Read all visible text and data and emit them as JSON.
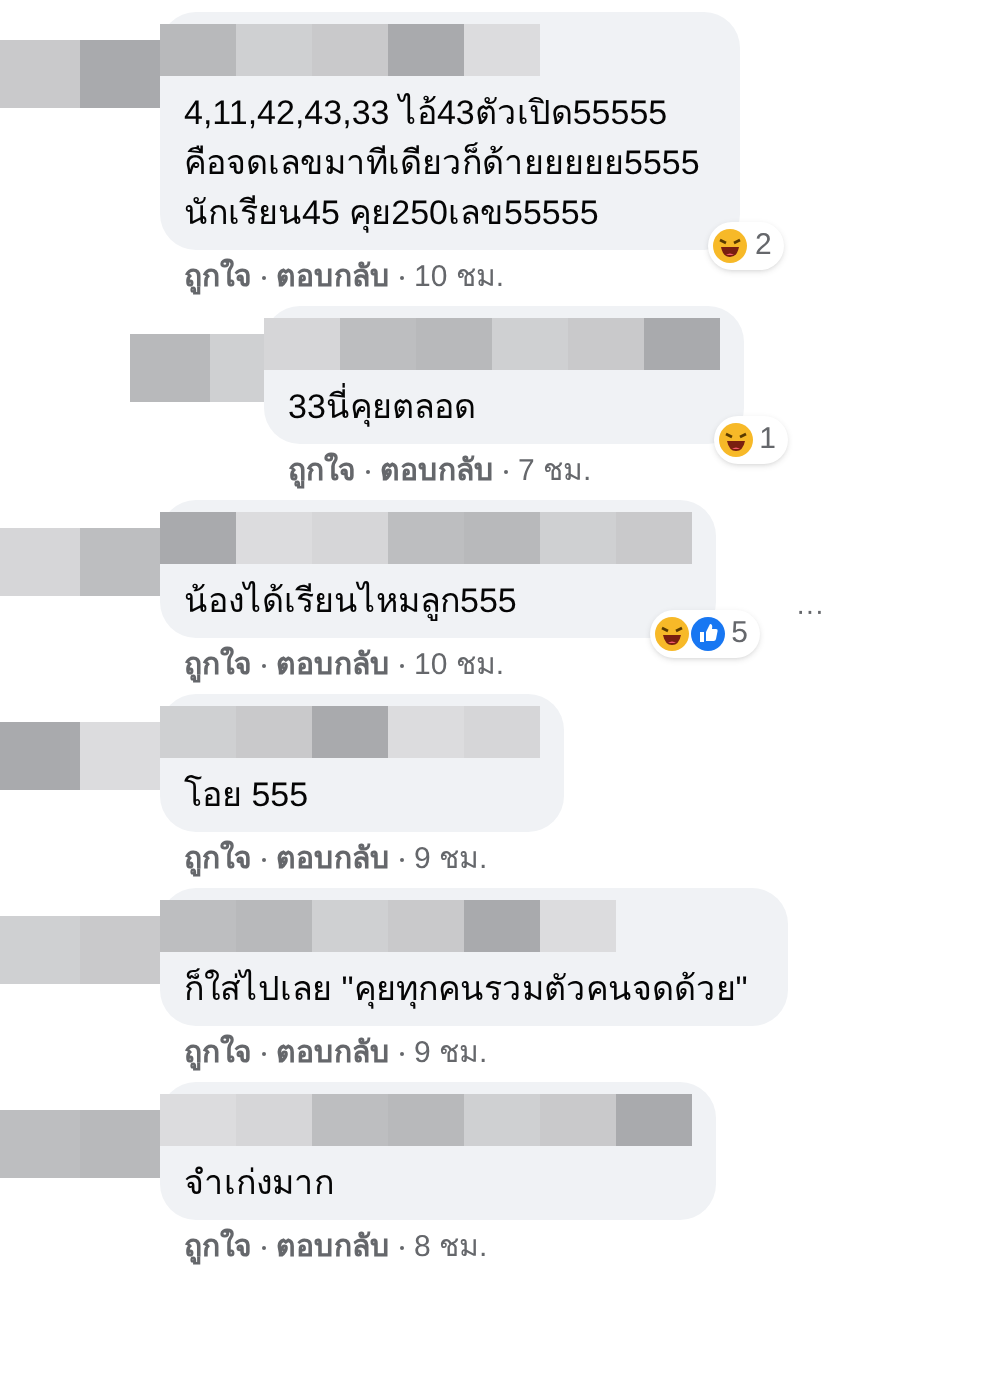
{
  "comments": [
    {
      "reply": false,
      "lines": [
        "4,11,42,43,33 ไอ้43ตัวเปิด55555",
        "คือจดเลขมาทีเดียวก็ด้ายยยยย5555",
        "นักเรียน45 คุย250เลข55555"
      ],
      "reactions": {
        "icons": [
          {
            "kind": "haha"
          }
        ],
        "count": "2"
      },
      "actions": {
        "like": "ถูกใจ",
        "reply": "ตอบกลับ",
        "time": "10 ชม."
      }
    },
    {
      "reply": true,
      "lines": [
        "33นี่คุยตลอด"
      ],
      "reactions": {
        "icons": [
          {
            "kind": "haha"
          }
        ],
        "count": "1"
      },
      "actions": {
        "like": "ถูกใจ",
        "reply": "ตอบกลับ",
        "time": "7 ชม."
      }
    },
    {
      "reply": false,
      "lines": [
        "น้องได้เรียนไหมลูก555"
      ],
      "reactions": {
        "icons": [
          {
            "kind": "haha"
          },
          {
            "kind": "like"
          }
        ],
        "count": "5"
      },
      "actions": {
        "like": "ถูกใจ",
        "reply": "ตอบกลับ",
        "time": "10 ชม."
      },
      "more_label": "···"
    },
    {
      "reply": false,
      "lines": [
        "โอย 555"
      ],
      "actions": {
        "like": "ถูกใจ",
        "reply": "ตอบกลับ",
        "time": "9 ชม."
      }
    },
    {
      "reply": false,
      "lines": [
        "ก็ใส่ไปเลย \"คุยทุกคนรวมตัวคนจดด้วย\""
      ],
      "actions": {
        "like": "ถูกใจ",
        "reply": "ตอบกลับ",
        "time": "9 ชม."
      }
    },
    {
      "reply": false,
      "lines": [
        "จำเก่งมาก"
      ],
      "actions": {
        "like": "ถูกใจ",
        "reply": "ตอบกลับ",
        "time": "8 ชม."
      }
    }
  ]
}
